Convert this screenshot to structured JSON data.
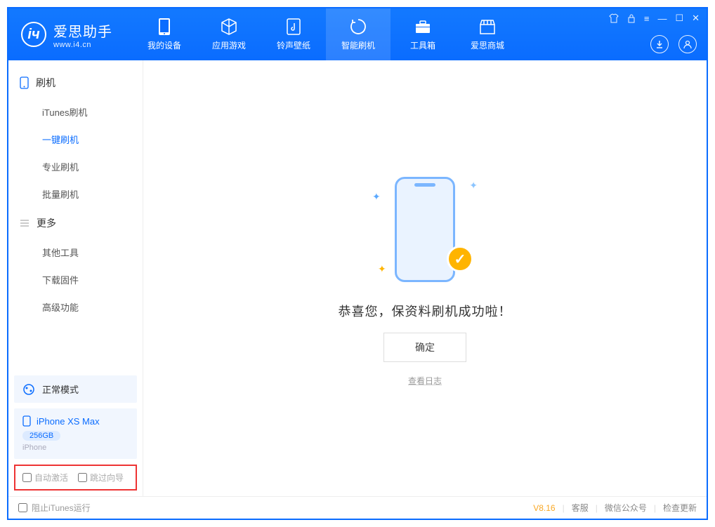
{
  "app": {
    "name": "爱思助手",
    "subtitle": "www.i4.cn"
  },
  "nav": {
    "items": [
      {
        "label": "我的设备"
      },
      {
        "label": "应用游戏"
      },
      {
        "label": "铃声壁纸"
      },
      {
        "label": "智能刷机"
      },
      {
        "label": "工具箱"
      },
      {
        "label": "爱思商城"
      }
    ],
    "active_index": 3
  },
  "sidebar": {
    "section1": {
      "title": "刷机",
      "items": [
        "iTunes刷机",
        "一键刷机",
        "专业刷机",
        "批量刷机"
      ],
      "active_index": 1
    },
    "section2": {
      "title": "更多",
      "items": [
        "其他工具",
        "下载固件",
        "高级功能"
      ]
    },
    "mode_label": "正常模式",
    "device": {
      "name": "iPhone XS Max",
      "storage": "256GB",
      "type": "iPhone"
    },
    "checks": {
      "auto_activate": "自动激活",
      "skip_guide": "跳过向导"
    }
  },
  "main": {
    "success_msg": "恭喜您，保资料刷机成功啦！",
    "ok_button": "确定",
    "log_link": "查看日志"
  },
  "footer": {
    "block_itunes": "阻止iTunes运行",
    "version": "V8.16",
    "links": [
      "客服",
      "微信公众号",
      "检查更新"
    ]
  }
}
